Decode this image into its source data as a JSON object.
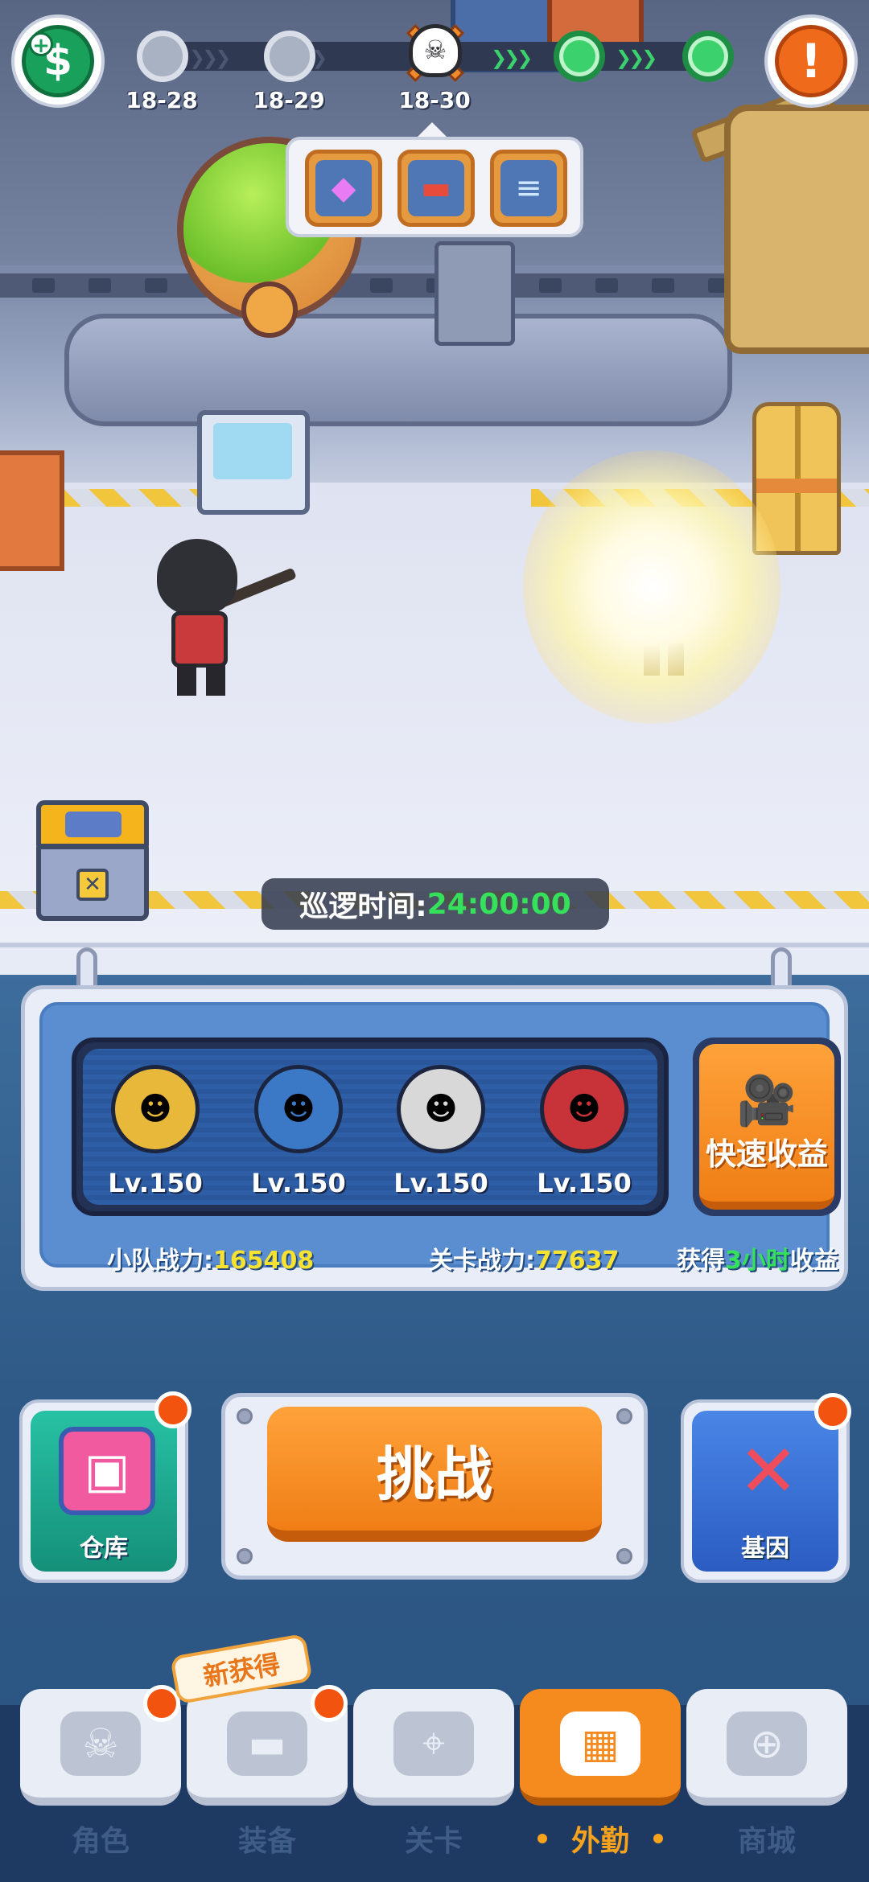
{
  "hud": {
    "coin_icon": "dollar-coin-icon",
    "coin_plus_glyph": "+",
    "coin_symbol": "$",
    "alert_icon": "exclamation-icon",
    "alert_symbol": "!"
  },
  "stage_progress": {
    "stages": [
      {
        "label": "18-28",
        "state": "locked"
      },
      {
        "label": "18-29",
        "state": "locked"
      },
      {
        "label": "18-30",
        "state": "boss"
      },
      {
        "label": "",
        "state": "cleared"
      },
      {
        "label": "",
        "state": "cleared"
      }
    ],
    "boss_icon": "skull-icon"
  },
  "rewards": [
    {
      "icon": "gem-icon",
      "glyph": "◆"
    },
    {
      "icon": "gun-blueprint-icon",
      "glyph": "▬"
    },
    {
      "icon": "document-icon",
      "glyph": "≡"
    }
  ],
  "patrol": {
    "label": "巡逻时间:",
    "value": "24:00:00"
  },
  "team": {
    "heroes": [
      {
        "level": "Lv.150",
        "color": "#e8b83a",
        "icon": "yellow-hero-icon"
      },
      {
        "level": "Lv.150",
        "color": "#3b79c7",
        "icon": "blue-hero-icon"
      },
      {
        "level": "Lv.150",
        "color": "#d8d8d8",
        "icon": "white-hero-icon"
      },
      {
        "level": "Lv.150",
        "color": "#c8333a",
        "icon": "red-hero-icon"
      }
    ],
    "quick_earn": {
      "label": "快速收益",
      "icon": "video-camera-icon"
    },
    "squad_power_label": "小队战力:",
    "squad_power_value": "165408",
    "stage_power_label": "关卡战力:",
    "stage_power_value": "77637",
    "earn_prefix": "获得",
    "earn_hours": "3小时",
    "earn_suffix": "收益"
  },
  "actions": {
    "warehouse_label": "仓库",
    "warehouse_icon": "safe-box-icon",
    "challenge_label": "挑战",
    "gene_label": "基因",
    "gene_icon": "dna-icon"
  },
  "nav": {
    "new_badge": "新获得",
    "tabs": [
      {
        "label": "角色",
        "icon": "skull-icon",
        "active": false
      },
      {
        "label": "装备",
        "icon": "gun-icon",
        "active": false
      },
      {
        "label": "关卡",
        "icon": "map-pin-icon",
        "active": false
      },
      {
        "label": "外勤",
        "icon": "console-icon",
        "active": true
      },
      {
        "label": "商城",
        "icon": "shop-icon",
        "active": false
      }
    ]
  },
  "colors": {
    "accent_orange": "#f58a1f",
    "timer_green": "#35e05b",
    "power_yellow": "#f7e232",
    "badge_red": "#f2540f"
  }
}
